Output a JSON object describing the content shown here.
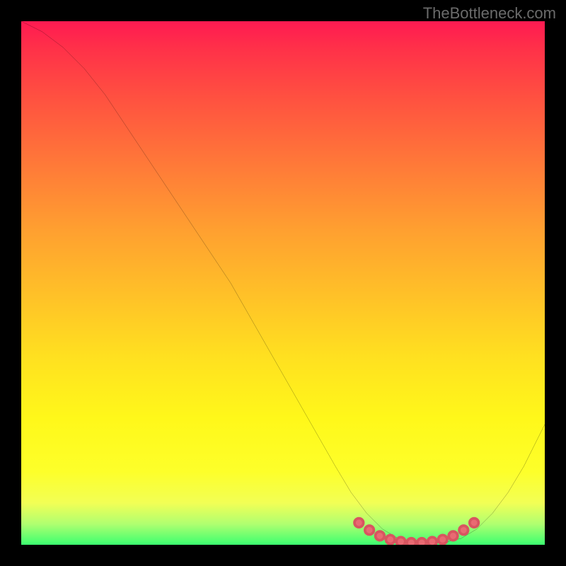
{
  "watermark": "TheBottleneck.com",
  "chart_data": {
    "type": "line",
    "title": "",
    "xlabel": "",
    "ylabel": "",
    "xlim": [
      0,
      100
    ],
    "ylim": [
      0,
      100
    ],
    "series": [
      {
        "name": "curve",
        "x": [
          0,
          4,
          8,
          12,
          16,
          20,
          24,
          28,
          32,
          36,
          40,
          44,
          48,
          52,
          56,
          60,
          63,
          66,
          69,
          72,
          75,
          78,
          81,
          84,
          87,
          90,
          93,
          96,
          99,
          100
        ],
        "y": [
          100,
          98,
          95,
          91,
          86,
          80,
          74,
          68,
          62,
          56,
          50,
          43,
          36,
          29,
          22,
          15,
          10,
          6,
          3,
          1.2,
          0.5,
          0.3,
          0.5,
          1.2,
          3,
          6,
          10,
          15,
          21,
          23
        ]
      }
    ],
    "highlight_points": {
      "name": "bottom-dots",
      "x": [
        64.5,
        66.5,
        68.5,
        70.5,
        72.5,
        74.5,
        76.5,
        78.5,
        80.5,
        82.5,
        84.5,
        86.5
      ],
      "y": [
        4.2,
        2.8,
        1.7,
        1.0,
        0.6,
        0.4,
        0.4,
        0.6,
        1.0,
        1.7,
        2.8,
        4.2
      ]
    },
    "background_gradient": {
      "stops": [
        {
          "pos": 0,
          "color": "#ff1a52"
        },
        {
          "pos": 5,
          "color": "#ff3049"
        },
        {
          "pos": 15,
          "color": "#ff5240"
        },
        {
          "pos": 28,
          "color": "#ff7b38"
        },
        {
          "pos": 40,
          "color": "#ffa030"
        },
        {
          "pos": 52,
          "color": "#ffc028"
        },
        {
          "pos": 64,
          "color": "#ffe020"
        },
        {
          "pos": 76,
          "color": "#fff81a"
        },
        {
          "pos": 86,
          "color": "#fdff2a"
        },
        {
          "pos": 92,
          "color": "#f2ff55"
        },
        {
          "pos": 96,
          "color": "#b0ff70"
        },
        {
          "pos": 100,
          "color": "#3cff70"
        }
      ]
    }
  }
}
